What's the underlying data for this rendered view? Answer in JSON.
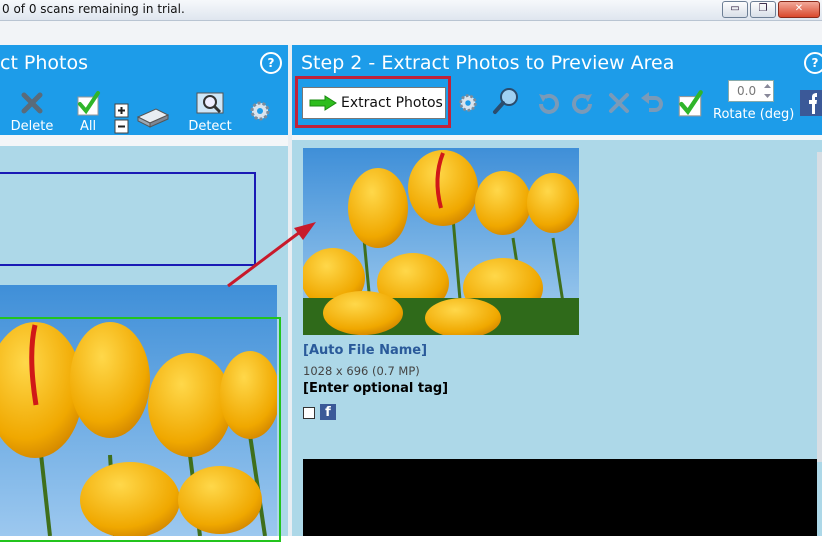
{
  "window": {
    "title": "0 of 0 scans remaining in trial.",
    "minimize": "▭",
    "restore": "❐",
    "close": "✕"
  },
  "left_panel": {
    "title": "ct Photos",
    "help": "?",
    "tools": {
      "delete": "Delete",
      "all": "All",
      "detect": "Detect"
    }
  },
  "right_panel": {
    "title": "Step 2 - Extract Photos to Preview Area",
    "help": "?",
    "extract_button": "Extract Photos",
    "rotate_value": "0.0",
    "rotate_label": "Rotate (deg)"
  },
  "preview": {
    "file_name": "[Auto File Name]",
    "dimensions": "1028 x 696 (0.7 MP)",
    "tag": "[Enter optional tag]",
    "facebook": "f"
  },
  "colors": {
    "header_blue": "#1d9ce9",
    "body_blue": "#add8e8",
    "highlight_red": "#c1223a",
    "arrow_red": "#c81a2b"
  }
}
